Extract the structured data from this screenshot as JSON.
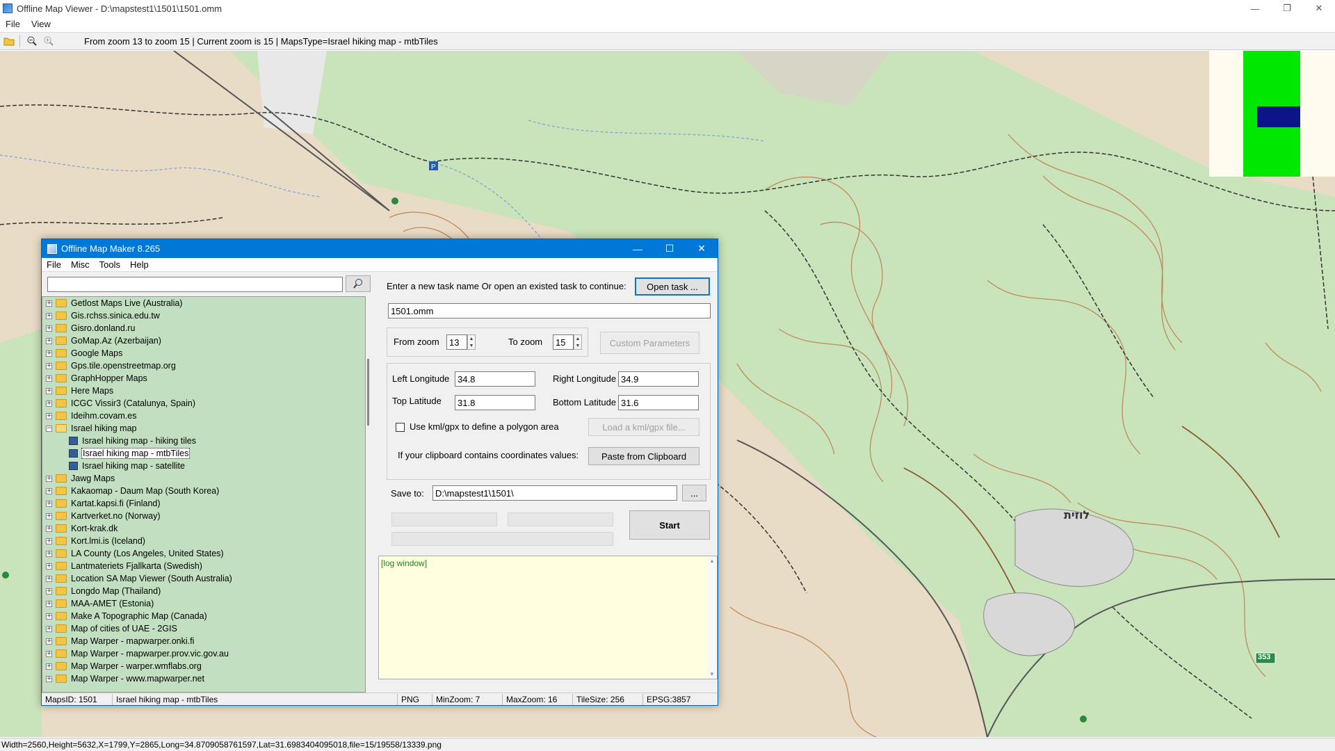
{
  "window": {
    "title": "Offline Map Viewer - D:\\mapstest1\\1501\\1501.omm",
    "minimize": "—",
    "maximize": "❐",
    "close": "✕"
  },
  "menu": {
    "file": "File",
    "view": "View"
  },
  "toolbar": {
    "info": "From zoom 13 to zoom 15   |   Current zoom is 15  |    MapsType=Israel hiking map - mtbTiles"
  },
  "map": {
    "place_label": "לוזית",
    "road_number": "353",
    "colors": {
      "land": "#e9dcc7",
      "forest": "#c9e3bb",
      "contour": "#c08a5a",
      "trail": "#333333",
      "water": "#7aa2d8"
    }
  },
  "statusbar": {
    "text": "Width=2560,Height=5632,X=1799,Y=2865,Long=34.8709058761597,Lat=31.6983404095018,file=15/19558/13339.png"
  },
  "dialog": {
    "title": "Offline Map Maker 8.265",
    "min": "—",
    "max": "☐",
    "close": "✕",
    "menu": {
      "file": "File",
      "misc": "Misc",
      "tools": "Tools",
      "help": "Help"
    },
    "search": {
      "value": ""
    },
    "tree": [
      {
        "label": "Getlost Maps Live (Australia)",
        "type": "folder",
        "sign": "+"
      },
      {
        "label": "Gis.rchss.sinica.edu.tw",
        "type": "folder",
        "sign": "+"
      },
      {
        "label": "Gisro.donland.ru",
        "type": "folder",
        "sign": "+"
      },
      {
        "label": "GoMap.Az (Azerbaijan)",
        "type": "folder",
        "sign": "+"
      },
      {
        "label": "Google Maps",
        "type": "folder",
        "sign": "+"
      },
      {
        "label": "Gps.tile.openstreetmap.org",
        "type": "folder",
        "sign": "+"
      },
      {
        "label": "GraphHopper Maps",
        "type": "folder",
        "sign": "+"
      },
      {
        "label": "Here Maps",
        "type": "folder",
        "sign": "+"
      },
      {
        "label": "ICGC Vissir3 (Catalunya, Spain)",
        "type": "folder",
        "sign": "+"
      },
      {
        "label": "Ideihm.covam.es",
        "type": "folder",
        "sign": "+"
      },
      {
        "label": "Israel hiking map",
        "type": "folder-open",
        "sign": "−"
      },
      {
        "label": "Israel hiking map - hiking tiles",
        "type": "map"
      },
      {
        "label": "Israel hiking map - mtbTiles",
        "type": "map",
        "selected": true
      },
      {
        "label": "Israel hiking map - satellite",
        "type": "map"
      },
      {
        "label": "Jawg Maps",
        "type": "folder",
        "sign": "+"
      },
      {
        "label": "Kakaomap - Daum Map (South Korea)",
        "type": "folder",
        "sign": "+"
      },
      {
        "label": "Kartat.kapsi.fi (Finland)",
        "type": "folder",
        "sign": "+"
      },
      {
        "label": "Kartverket.no (Norway)",
        "type": "folder",
        "sign": "+"
      },
      {
        "label": "Kort-krak.dk",
        "type": "folder",
        "sign": "+"
      },
      {
        "label": "Kort.lmi.is (Iceland)",
        "type": "folder",
        "sign": "+"
      },
      {
        "label": "LA County (Los Angeles, United States)",
        "type": "folder",
        "sign": "+"
      },
      {
        "label": "Lantmateriets Fjallkarta (Swedish)",
        "type": "folder",
        "sign": "+"
      },
      {
        "label": "Location SA Map Viewer (South Australia)",
        "type": "folder",
        "sign": "+"
      },
      {
        "label": "Longdo Map (Thailand)",
        "type": "folder",
        "sign": "+"
      },
      {
        "label": "MAA-AMET (Estonia)",
        "type": "folder",
        "sign": "+"
      },
      {
        "label": "Make A Topographic Map (Canada)",
        "type": "folder",
        "sign": "+"
      },
      {
        "label": "Map of cities of UAE - 2GIS",
        "type": "folder",
        "sign": "+"
      },
      {
        "label": "Map Warper - mapwarper.onki.fi",
        "type": "folder",
        "sign": "+"
      },
      {
        "label": "Map Warper - mapwarper.prov.vic.gov.au",
        "type": "folder",
        "sign": "+"
      },
      {
        "label": "Map Warper - warper.wmflabs.org",
        "type": "folder",
        "sign": "+"
      },
      {
        "label": "Map Warper - www.mapwarper.net",
        "type": "folder",
        "sign": "+"
      }
    ],
    "task_prompt": "Enter a new task name Or open an existed task to continue:",
    "open_task": "Open task ...",
    "task_name": "1501.omm",
    "from_zoom_label": "From zoom",
    "from_zoom": "13",
    "to_zoom_label": "To zoom",
    "to_zoom": "15",
    "custom_params": "Custom Parameters",
    "left_lon_label": "Left Longitude",
    "left_lon": "34.8",
    "right_lon_label": "Right Longitude",
    "right_lon": "34.9",
    "top_lat_label": "Top Latitude",
    "top_lat": "31.8",
    "bottom_lat_label": "Bottom Latitude",
    "bottom_lat": "31.6",
    "kml_label": "Use kml/gpx to define a polygon area",
    "load_kml": "Load a kml/gpx file...",
    "clipboard_label": "If your clipboard contains coordinates values:",
    "paste_clipboard": "Paste from Clipboard",
    "save_to_label": "Save to:",
    "save_to": "D:\\mapstest1\\1501\\",
    "browse": "...",
    "start": "Start",
    "log": "[log window]",
    "status": {
      "maps_id": "MapsID: 1501",
      "map_name": "Israel hiking map - mtbTiles",
      "format": "PNG",
      "min_zoom": "MinZoom: 7",
      "max_zoom": "MaxZoom: 16",
      "tile_size": "TileSize: 256",
      "epsg": "EPSG:3857"
    }
  }
}
